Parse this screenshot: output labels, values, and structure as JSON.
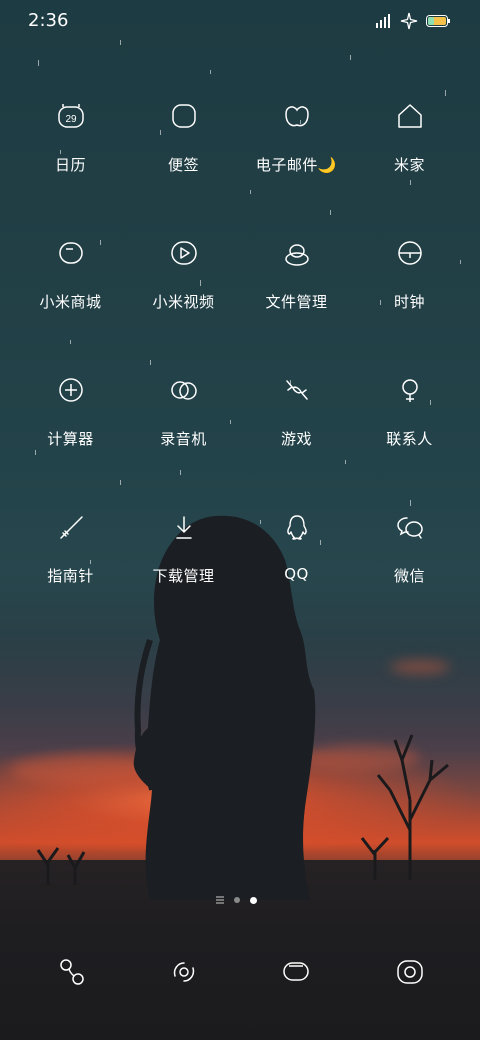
{
  "status_bar": {
    "time": "2:36",
    "icons": [
      "signal-icon",
      "sparkle-icon",
      "battery-icon"
    ],
    "battery_color": "#f4c24a"
  },
  "apps": [
    {
      "label": "日历",
      "icon": "calendar-icon",
      "badge": "29"
    },
    {
      "label": "便签",
      "icon": "notes-icon"
    },
    {
      "label": "电子邮件🌙",
      "icon": "email-icon"
    },
    {
      "label": "米家",
      "icon": "home-icon"
    },
    {
      "label": "小米商城",
      "icon": "mall-icon"
    },
    {
      "label": "小米视频",
      "icon": "video-icon"
    },
    {
      "label": "文件管理",
      "icon": "files-icon"
    },
    {
      "label": "时钟",
      "icon": "clock-icon"
    },
    {
      "label": "计算器",
      "icon": "calculator-icon"
    },
    {
      "label": "录音机",
      "icon": "recorder-icon"
    },
    {
      "label": "游戏",
      "icon": "game-icon"
    },
    {
      "label": "联系人",
      "icon": "contacts-icon"
    },
    {
      "label": "指南针",
      "icon": "compass-icon"
    },
    {
      "label": "下载管理",
      "icon": "download-icon"
    },
    {
      "label": "QQ",
      "icon": "qq-icon"
    },
    {
      "label": "微信",
      "icon": "wechat-icon"
    }
  ],
  "page_indicator": {
    "pages": 3,
    "current": 3
  },
  "dock": [
    {
      "icon": "phone-icon"
    },
    {
      "icon": "browser-icon"
    },
    {
      "icon": "messages-icon"
    },
    {
      "icon": "camera-icon"
    }
  ]
}
